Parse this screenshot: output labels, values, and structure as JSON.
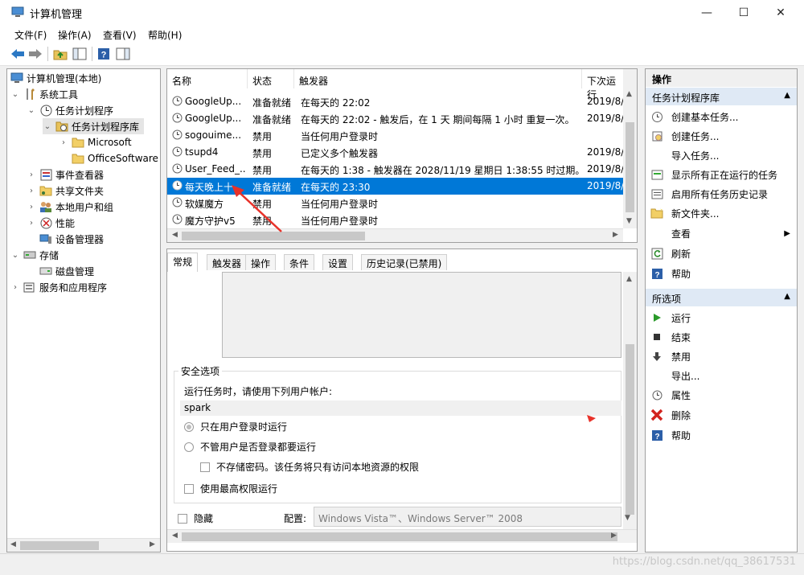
{
  "window": {
    "title": "计算机管理",
    "minimize": "—",
    "maximize": "☐",
    "close": "✕"
  },
  "menu": [
    "文件(F)",
    "操作(A)",
    "查看(V)",
    "帮助(H)"
  ],
  "tree": {
    "items": [
      {
        "label": "计算机管理(本地)",
        "icon": "computer-icon"
      },
      {
        "label": "系统工具",
        "icon": "tools-icon"
      },
      {
        "label": "任务计划程序",
        "icon": "clock-icon"
      },
      {
        "label": "任务计划程序库",
        "icon": "folder-clock-icon"
      },
      {
        "label": "Microsoft",
        "icon": "folder-icon"
      },
      {
        "label": "OfficeSoftware",
        "icon": "folder-icon"
      },
      {
        "label": "事件查看器",
        "icon": "event-viewer-icon"
      },
      {
        "label": "共享文件夹",
        "icon": "shared-folder-icon"
      },
      {
        "label": "本地用户和组",
        "icon": "users-icon"
      },
      {
        "label": "性能",
        "icon": "performance-icon"
      },
      {
        "label": "设备管理器",
        "icon": "device-manager-icon"
      },
      {
        "label": "存储",
        "icon": "storage-icon"
      },
      {
        "label": "磁盘管理",
        "icon": "disk-icon"
      },
      {
        "label": "服务和应用程序",
        "icon": "services-icon"
      }
    ]
  },
  "task_list": {
    "columns": [
      "名称",
      "状态",
      "触发器",
      "下次运行"
    ],
    "rows": [
      {
        "name": "GoogleUp...",
        "status": "准备就绪",
        "trigger": "在每天的 22:02",
        "next": "2019/8/"
      },
      {
        "name": "GoogleUp...",
        "status": "准备就绪",
        "trigger": "在每天的 22:02 - 触发后，在 1 天 期间每隔 1 小时 重复一次。",
        "next": "2019/8/"
      },
      {
        "name": "sogouime...",
        "status": "禁用",
        "trigger": "当任何用户登录时",
        "next": ""
      },
      {
        "name": "tsupd4",
        "status": "禁用",
        "trigger": "已定义多个触发器",
        "next": "2019/8/"
      },
      {
        "name": "User_Feed_...",
        "status": "禁用",
        "trigger": "在每天的 1:38 - 触发器在 2028/11/19 星期日 1:38:55 时过期。",
        "next": "2019/8/"
      },
      {
        "name": "每天晚上十...",
        "status": "准备就绪",
        "trigger": "在每天的 23:30",
        "next": "2019/8/"
      },
      {
        "name": "软媒魔方",
        "status": "禁用",
        "trigger": "当任何用户登录时",
        "next": ""
      },
      {
        "name": "魔方守护v5",
        "status": "禁用",
        "trigger": "当任何用户登录时",
        "next": ""
      }
    ]
  },
  "detail": {
    "tabs": [
      "常规",
      "触发器",
      "操作",
      "条件",
      "设置",
      "历史记录(已禁用)"
    ],
    "security_title": "安全选项",
    "run_as_label": "运行任务时，请使用下列用户帐户:",
    "user_account": "spark",
    "radio_logged_on": "只在用户登录时运行",
    "radio_any": "不管用户是否登录都要运行",
    "no_store_password": "不存储密码。该任务将只有访问本地资源的权限",
    "highest_privileges": "使用最高权限运行",
    "hidden_label": "隐藏",
    "config_label": "配置:",
    "config_value": "Windows Vista™、Windows Server™ 2008"
  },
  "actions": {
    "header": "操作",
    "section1": "任务计划程序库",
    "items1": [
      {
        "label": "创建基本任务...",
        "icon": "create-basic-task-icon"
      },
      {
        "label": "创建任务...",
        "icon": "create-task-icon"
      },
      {
        "label": "导入任务...",
        "icon": ""
      },
      {
        "label": "显示所有正在运行的任务",
        "icon": "running-tasks-icon"
      },
      {
        "label": "启用所有任务历史记录",
        "icon": "history-icon"
      },
      {
        "label": "新文件夹...",
        "icon": "new-folder-icon"
      },
      {
        "label": "查看",
        "icon": ""
      },
      {
        "label": "刷新",
        "icon": "refresh-icon"
      },
      {
        "label": "帮助",
        "icon": "help-icon"
      }
    ],
    "section2": "所选项",
    "items2": [
      {
        "label": "运行",
        "icon": "run-icon"
      },
      {
        "label": "结束",
        "icon": "stop-icon"
      },
      {
        "label": "禁用",
        "icon": "disable-icon"
      },
      {
        "label": "导出...",
        "icon": ""
      },
      {
        "label": "属性",
        "icon": "properties-icon"
      },
      {
        "label": "删除",
        "icon": "delete-icon"
      },
      {
        "label": "帮助",
        "icon": "help-icon"
      }
    ]
  },
  "watermark": "https://blog.csdn.net/qq_38617531",
  "colors": {
    "selection": "#0078d7",
    "annotation_arrow": "#e8322a"
  }
}
